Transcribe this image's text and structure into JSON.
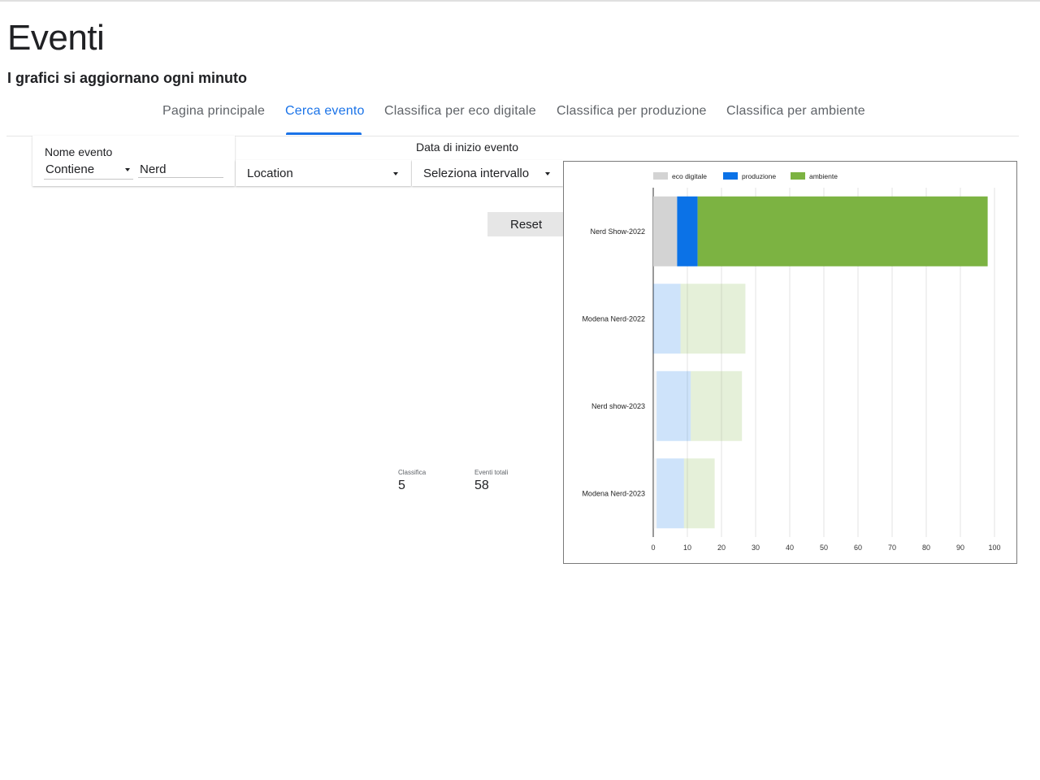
{
  "header": {
    "title": "Eventi",
    "subtitle": "I grafici si aggiornano ogni minuto"
  },
  "tabs": [
    {
      "label": "Pagina principale",
      "active": false
    },
    {
      "label": "Cerca evento",
      "active": true
    },
    {
      "label": "Classifica per eco digitale",
      "active": false
    },
    {
      "label": "Classifica per produzione",
      "active": false
    },
    {
      "label": "Classifica per ambiente",
      "active": false
    }
  ],
  "filters": {
    "event_name": {
      "label": "Nome evento",
      "operator": "Contiene",
      "value": "Nerd"
    },
    "location": {
      "value": "Location"
    },
    "start_date": {
      "label": "Data di inizio evento",
      "value": "Seleziona intervallo"
    },
    "reset_label": "Reset"
  },
  "kpis": [
    {
      "label": "Classifica",
      "value": "5"
    },
    {
      "label": "Eventi totali",
      "value": "58"
    }
  ],
  "colors": {
    "accent": "#1a73e8",
    "eco_digitale": "#d3d3d3",
    "produzione": "#0b72e7",
    "ambiente": "#7cb342"
  },
  "chart_data": {
    "type": "bar",
    "orientation": "horizontal",
    "stacked": true,
    "categories": [
      "Nerd Show-2022",
      "Modena Nerd-2022",
      "Nerd show-2023",
      "Modena Nerd-2023"
    ],
    "series": [
      {
        "name": "eco digitale",
        "color": "#d3d3d3",
        "values": [
          7,
          0,
          1,
          1
        ]
      },
      {
        "name": "produzione",
        "color": "#0b72e7",
        "values": [
          6,
          8,
          10,
          8
        ]
      },
      {
        "name": "ambiente",
        "color": "#7cb342",
        "values": [
          85,
          19,
          15,
          9
        ]
      }
    ],
    "highlighted": "Nerd Show-2022",
    "xlim": [
      0,
      100
    ],
    "xticks": [
      "0",
      "10",
      "20",
      "30",
      "40",
      "50",
      "60",
      "70",
      "80",
      "90",
      "100"
    ],
    "legend": "top",
    "grid": true
  }
}
